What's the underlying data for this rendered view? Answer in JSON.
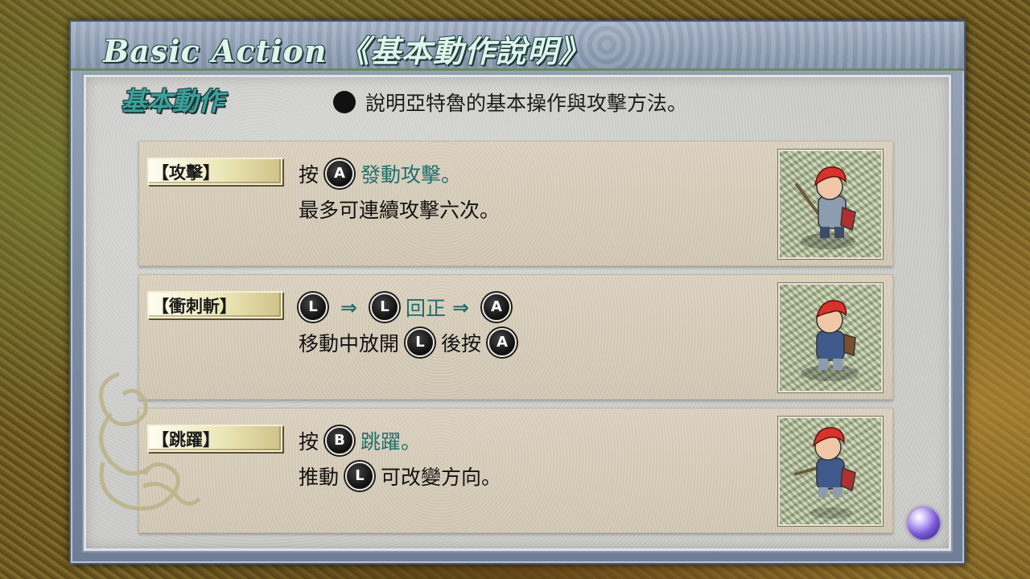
{
  "header": {
    "title": "Basic Action 《基本動作說明》"
  },
  "section": {
    "title": "基本動作",
    "intro": "說明亞特魯的基本操作與攻擊方法。"
  },
  "rows": [
    {
      "label": "【攻擊】",
      "line1": {
        "pre": "按",
        "button": "A",
        "post": "發動攻擊。"
      },
      "line2": "最多可連續攻擊六次。"
    },
    {
      "label": "【衝刺斬】",
      "line1": {
        "b1": "L",
        "arrow1": "⇒",
        "b2": "L",
        "mid": "回正",
        "arrow2": "⇒",
        "b3": "A"
      },
      "line2": {
        "pre": "移動中放開",
        "b1": "L",
        "mid": "後按",
        "b2": "A"
      }
    },
    {
      "label": "【跳躍】",
      "line1": {
        "pre": "按",
        "button": "B",
        "post": "跳躍。"
      },
      "line2": {
        "pre": "推動",
        "button": "L",
        "post": "可改變方向。"
      }
    }
  ],
  "icons": {
    "bullet": "filled-circle",
    "buttons": "gamepad-button",
    "hero": "red-haired-swordsman",
    "ornament": "celtic-scroll",
    "orb": "purple-orb"
  },
  "colors": {
    "title_text": "#dff4ea",
    "section_title": "#3f9f9a",
    "highlight_text": "#1f6e6c",
    "frame": "#8696ae"
  }
}
